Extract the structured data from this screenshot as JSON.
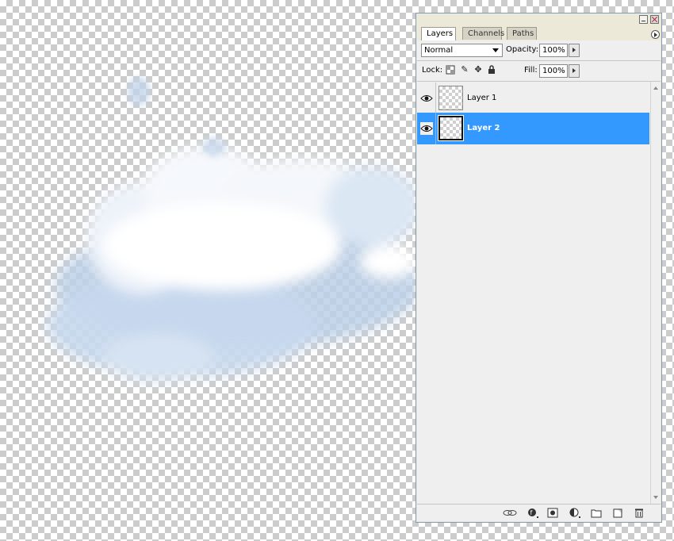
{
  "panel": {
    "tabs": [
      {
        "label": "Layers",
        "active": true
      },
      {
        "label": "Channels",
        "active": false
      },
      {
        "label": "Paths",
        "active": false
      }
    ],
    "blend_mode": "Normal",
    "opacity_label": "Opacity:",
    "opacity_value": "100%",
    "lock_label": "Lock:",
    "fill_label": "Fill:",
    "fill_value": "100%",
    "layers": [
      {
        "name": "Layer 1",
        "selected": false,
        "visible": true
      },
      {
        "name": "Layer 2",
        "selected": true,
        "visible": true
      }
    ],
    "bottom_icons": [
      "link-icon",
      "layer-style-icon",
      "add-mask-icon",
      "adjustment-layer-icon",
      "new-group-icon",
      "new-layer-icon",
      "trash-icon"
    ],
    "colors": {
      "selection": "#3399ff",
      "panel_bg": "#ece9d8"
    }
  }
}
